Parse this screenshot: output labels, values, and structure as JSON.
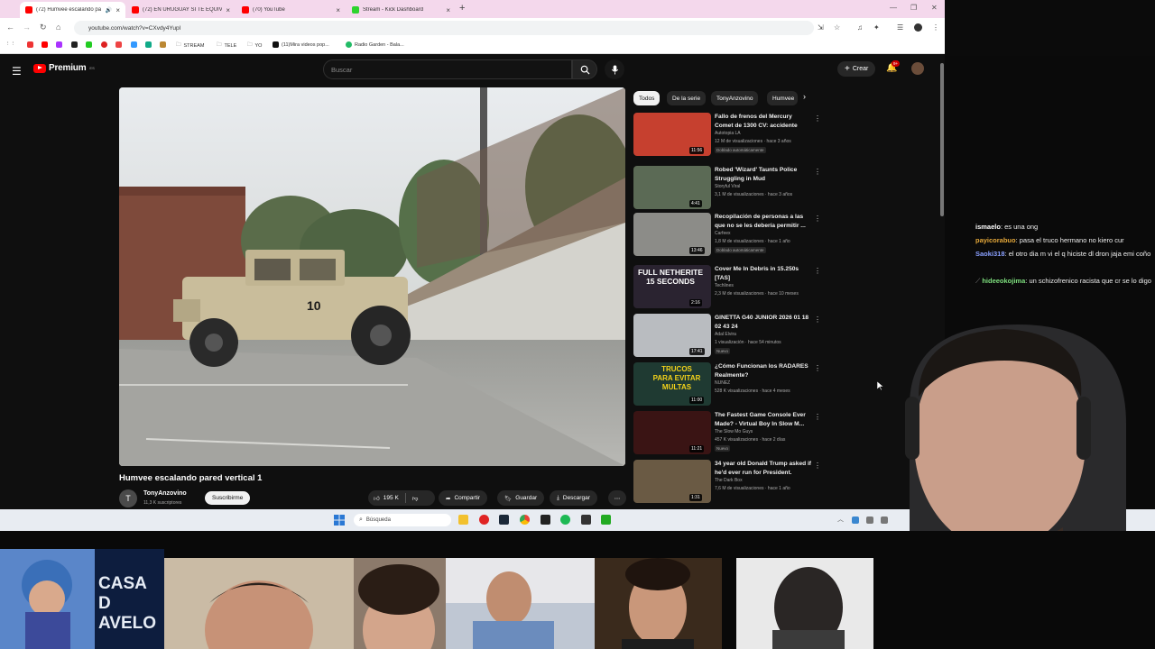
{
  "browser": {
    "tabs": [
      {
        "title": "(72) Humvee escalando pa",
        "active": true,
        "favicon": "youtube-icon"
      },
      {
        "title": "(72) EN URUGUAY SI TE EQUIVO",
        "active": false,
        "favicon": "youtube-icon"
      },
      {
        "title": "(70) YouTube",
        "active": false,
        "favicon": "youtube-icon"
      },
      {
        "title": "Stream - Kick Dashboard",
        "active": false,
        "favicon": "kick-icon"
      }
    ],
    "new_tab": "+",
    "url": "youtube.com/watch?v=CXvdy4YupI",
    "bookmarks": [
      "STREAM",
      "TELE",
      "YO",
      "(11)Mira videos pop...",
      "Radio Garden - Bala..."
    ]
  },
  "youtube": {
    "logo_text": "Premium",
    "logo_sup": "ES",
    "search_placeholder": "Buscar",
    "create_label": "Crear",
    "notif_count": "9+",
    "video_title": "Humvee escalando pared vertical 1",
    "channel_initial": "T",
    "channel_name": "TonyAnzovino",
    "channel_subs": "11,3 K suscriptores",
    "subscribe_label": "Suscribirme",
    "likes": "195 K",
    "share_label": "Compartir",
    "save_label": "Guardar",
    "download_label": "Descargar",
    "chips": [
      {
        "label": "Todos",
        "active": true
      },
      {
        "label": "De la serie",
        "active": false
      },
      {
        "label": "TonyAnzovino",
        "active": false
      },
      {
        "label": "Humvee",
        "active": false
      }
    ],
    "related": [
      {
        "title": "Fallo de frenos del Mercury Comet de 1300 CV: accidente",
        "channel": "Autotopia LA",
        "meta": "12 M de visualizaciones · hace 3 años",
        "badge": "Doblado automáticamente",
        "duration": "11:56",
        "color": "#c6402f"
      },
      {
        "title": "Robed 'Wizard' Taunts Police Struggling in Mud",
        "channel": "Storyful Viral",
        "meta": "3,1 M de visualizaciones · hace 3 años",
        "badge": "",
        "duration": "4:41",
        "color": "#5b6a55"
      },
      {
        "title": "Recopilación de personas a las que no se les debería permitir ...",
        "channel": "Carfeex",
        "meta": "1,8 M de visualizaciones · hace 1 año",
        "badge": "Doblado automáticamente",
        "duration": "13:46",
        "color": "#8c8c88"
      },
      {
        "title": "Cover Me In Debris in 15.250s [TAS]",
        "channel": "Techlines",
        "meta": "2,3 M de visualizaciones · hace 10 meses",
        "badge": "",
        "duration": "2:16",
        "color": "#2a2330"
      },
      {
        "title": "GINETTA G40 JUNIOR 2026 01 18 02 43 24",
        "channel": "Adal Elvira",
        "meta": "1 visualización · hace 54 minutos",
        "badge": "Nuevo",
        "duration": "17:41",
        "color": "#b9bcc0"
      },
      {
        "title": "¿Cómo Funcionan los RADARES Realmente?",
        "channel": "NUNEZ",
        "meta": "528 K visualizaciones · hace 4 meses",
        "badge": "",
        "duration": "11:00",
        "color": "#1f3a32"
      },
      {
        "title": "The Fastest Game Console Ever Made? - Virtual Boy In Slow M...",
        "channel": "The Slow Mo Guys",
        "meta": "457 K visualizaciones · hace 2 días",
        "badge": "Nuevo",
        "duration": "11:21",
        "color": "#3a1414"
      },
      {
        "title": "34 year old Donald Trump asked if he'd ever run for President.",
        "channel": "The Dark Box",
        "meta": "7,6 M de visualizaciones · hace 1 año",
        "badge": "",
        "duration": "1:31",
        "color": "#6a5a44"
      }
    ],
    "thumb_texts": {
      "netherite": "FULL NETHERITE 15 SECONDS",
      "radares": "TRUCOS PARA EVITAR MULTAS"
    },
    "video_overlay_number": "10"
  },
  "taskbar": {
    "search_placeholder": "Búsqueda"
  },
  "chat": [
    {
      "user": "ismaelo",
      "text": ": es una ong",
      "color": "#ffffff"
    },
    {
      "user": "payicorabuo",
      "text": ": pasa el truco hermano no kiero cur",
      "color": "#e6a93a"
    },
    {
      "user": "Saoki318",
      "text": ": el otro dia m vi el q hiciste dl dron jaja emi coño",
      "color": "#8aa0ff"
    },
    {
      "user": "hideeokojima",
      "text": ": un schizofrenico racista que cr se lo digo",
      "color": "#7ee07e"
    }
  ],
  "stream_strip": {
    "casa_text": "CASA D AVELO"
  }
}
